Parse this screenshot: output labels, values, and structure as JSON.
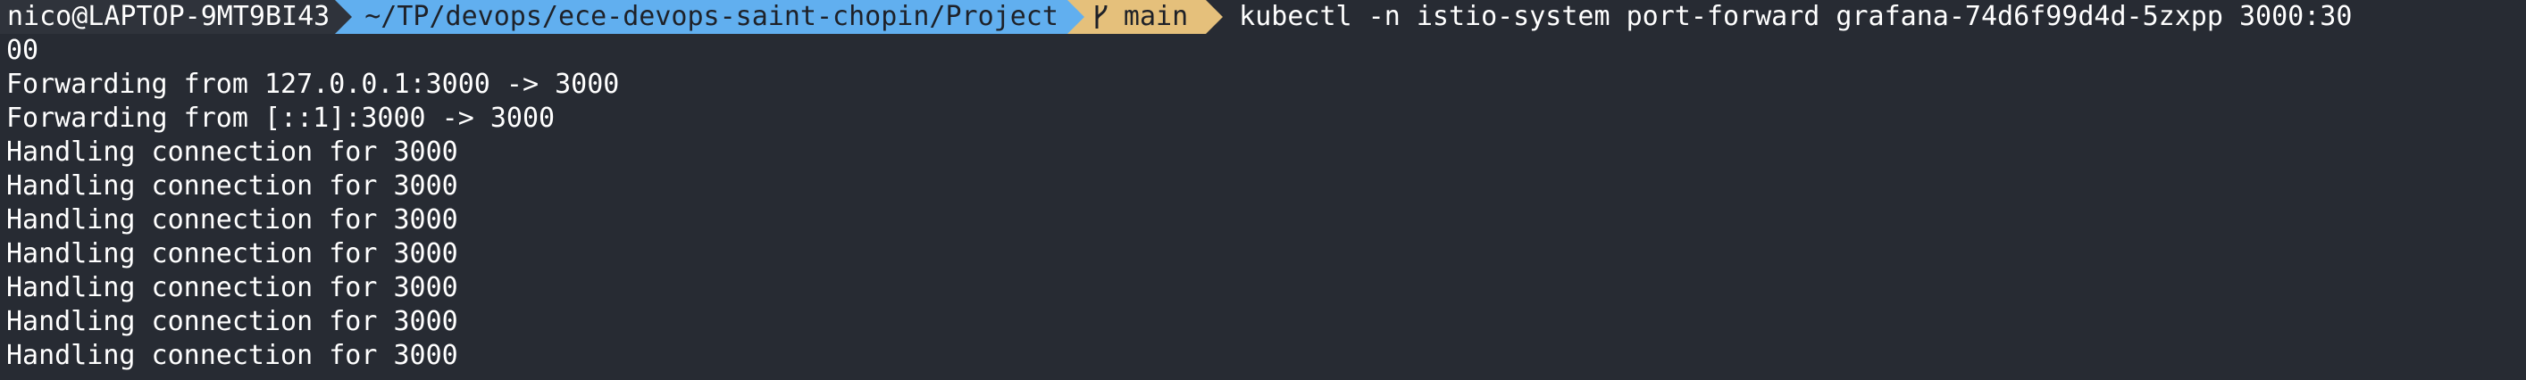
{
  "prompt": {
    "user_host": "nico@LAPTOP-9MT9BI43",
    "path": "~/TP/devops/ece-devops-saint-chopin/Project",
    "branch_icon": "git-branch-icon",
    "branch": "main",
    "command": "kubectl -n istio-system port-forward grafana-74d6f99d4d-5zxpp 3000:30",
    "command_wrap": "00"
  },
  "output": [
    "Forwarding from 127.0.0.1:3000 -> 3000",
    "Forwarding from [::1]:3000 -> 3000",
    "Handling connection for 3000",
    "Handling connection for 3000",
    "Handling connection for 3000",
    "Handling connection for 3000",
    "Handling connection for 3000",
    "Handling connection for 3000",
    "Handling connection for 3000"
  ],
  "colors": {
    "background": "#272b33",
    "user_segment": "#2f333b",
    "path_segment": "#61afef",
    "git_segment": "#e5c07b",
    "text": "#ffffff"
  }
}
